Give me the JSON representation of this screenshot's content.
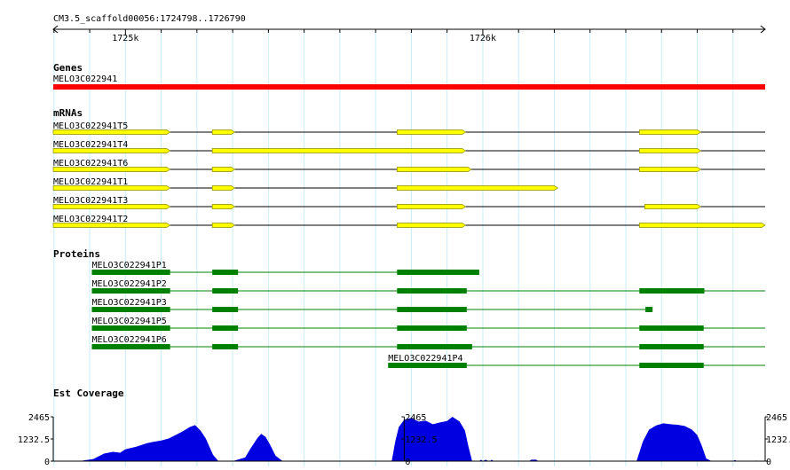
{
  "coord_label": "CM3.5_scaffold00056:1724798..1726790",
  "ruler": {
    "ticks": [
      {
        "pos": 1725000,
        "label": "1725k"
      },
      {
        "pos": 1726000,
        "label": "1726k"
      }
    ]
  },
  "range": {
    "start": 1724798,
    "end": 1726790
  },
  "colors": {
    "gene": "#ff0000",
    "mrna_fill": "#ffff00",
    "protein": "#008000",
    "coverage": "#0000e0",
    "grid": "#c8eef8"
  },
  "tracks": {
    "genes": {
      "title": "Genes",
      "items": [
        {
          "name": "MELO3C022941",
          "start": 1724798,
          "end": 1726790
        }
      ]
    },
    "mrnas": {
      "title": "mRNAs",
      "items": [
        {
          "name": "MELO3C022941T5",
          "exons": [
            [
              1724798,
              1725125
            ],
            [
              1725243,
              1725306
            ],
            [
              1725760,
              1725952
            ],
            [
              1726438,
              1726610
            ]
          ],
          "line": [
            1724798,
            1726790
          ]
        },
        {
          "name": "MELO3C022941T4",
          "exons": [
            [
              1724798,
              1725125
            ],
            [
              1725243,
              1725952
            ],
            [
              1726438,
              1726610
            ]
          ],
          "line": [
            1724798,
            1726790
          ]
        },
        {
          "name": "MELO3C022941T6",
          "exons": [
            [
              1724798,
              1725125
            ],
            [
              1725243,
              1725306
            ],
            [
              1725760,
              1725968
            ],
            [
              1726438,
              1726610
            ]
          ],
          "line": [
            1724798,
            1726790
          ]
        },
        {
          "name": "MELO3C022941T1",
          "exons": [
            [
              1724798,
              1725125
            ],
            [
              1725243,
              1725306
            ],
            [
              1725760,
              1726210
            ]
          ],
          "line": [
            1724798,
            1726210
          ]
        },
        {
          "name": "MELO3C022941T3",
          "exons": [
            [
              1724798,
              1725125
            ],
            [
              1725243,
              1725306
            ],
            [
              1725760,
              1725952
            ],
            [
              1726453,
              1726610
            ]
          ],
          "line": [
            1724798,
            1726790
          ]
        },
        {
          "name": "MELO3C022941T2",
          "exons": [
            [
              1724798,
              1725125
            ],
            [
              1725243,
              1725306
            ],
            [
              1725760,
              1725952
            ],
            [
              1726438,
              1726790
            ]
          ],
          "line": [
            1724798,
            1726790
          ]
        }
      ]
    },
    "proteins": {
      "title": "Proteins",
      "items": [
        {
          "name": "MELO3C022941P1",
          "blocks": [
            [
              1724906,
              1725125
            ],
            [
              1725243,
              1725315
            ],
            [
              1725760,
              1725990
            ]
          ],
          "line": [
            1724906,
            1725990
          ],
          "label_at": 1724906
        },
        {
          "name": "MELO3C022941P2",
          "blocks": [
            [
              1724906,
              1725125
            ],
            [
              1725243,
              1725315
            ],
            [
              1725760,
              1725955
            ],
            [
              1726438,
              1726620
            ]
          ],
          "line": [
            1724906,
            1726790
          ],
          "label_at": 1724906
        },
        {
          "name": "MELO3C022941P3",
          "blocks": [
            [
              1724906,
              1725125
            ],
            [
              1725243,
              1725315
            ],
            [
              1725760,
              1725955
            ],
            [
              1726455,
              1726475
            ]
          ],
          "line": [
            1724906,
            1726475
          ],
          "label_at": 1724906
        },
        {
          "name": "MELO3C022941P5",
          "blocks": [
            [
              1724906,
              1725125
            ],
            [
              1725243,
              1725315
            ],
            [
              1725760,
              1725955
            ],
            [
              1726438,
              1726618
            ]
          ],
          "line": [
            1724906,
            1726790
          ],
          "label_at": 1724906
        },
        {
          "name": "MELO3C022941P6",
          "blocks": [
            [
              1724906,
              1725125
            ],
            [
              1725243,
              1725315
            ],
            [
              1725760,
              1725970
            ],
            [
              1726438,
              1726618
            ]
          ],
          "line": [
            1724906,
            1726790
          ],
          "label_at": 1724906
        },
        {
          "name": "MELO3C022941P4",
          "blocks": [
            [
              1725735,
              1725955
            ],
            [
              1726438,
              1726618
            ]
          ],
          "line": [
            1725735,
            1726790
          ],
          "label_at": 1725735
        }
      ]
    },
    "coverage": {
      "title": "Est Coverage",
      "max_label": "2465",
      "mid_label": "1232.5",
      "zero_label": "0",
      "axis_positions": [
        1724798,
        1725780,
        1726790
      ],
      "points": [
        [
          1724798,
          0
        ],
        [
          1724870,
          0
        ],
        [
          1724910,
          120
        ],
        [
          1724940,
          420
        ],
        [
          1724965,
          520
        ],
        [
          1724985,
          470
        ],
        [
          1725000,
          660
        ],
        [
          1725030,
          800
        ],
        [
          1725060,
          1000
        ],
        [
          1725080,
          1080
        ],
        [
          1725100,
          1150
        ],
        [
          1725120,
          1250
        ],
        [
          1725140,
          1450
        ],
        [
          1725160,
          1650
        ],
        [
          1725180,
          1900
        ],
        [
          1725195,
          2000
        ],
        [
          1725210,
          1700
        ],
        [
          1725225,
          1250
        ],
        [
          1725245,
          350
        ],
        [
          1725260,
          0
        ],
        [
          1725300,
          0
        ],
        [
          1725335,
          200
        ],
        [
          1725350,
          700
        ],
        [
          1725370,
          1300
        ],
        [
          1725380,
          1520
        ],
        [
          1725392,
          1350
        ],
        [
          1725405,
          900
        ],
        [
          1725420,
          300
        ],
        [
          1725440,
          0
        ],
        [
          1725745,
          0
        ],
        [
          1725755,
          1100
        ],
        [
          1725765,
          1900
        ],
        [
          1725780,
          2300
        ],
        [
          1725800,
          2400
        ],
        [
          1725820,
          2200
        ],
        [
          1725840,
          2250
        ],
        [
          1725860,
          2050
        ],
        [
          1725880,
          2150
        ],
        [
          1725900,
          2230
        ],
        [
          1725915,
          2465
        ],
        [
          1725935,
          2200
        ],
        [
          1725950,
          1700
        ],
        [
          1725960,
          800
        ],
        [
          1725970,
          0
        ],
        [
          1725990,
          0
        ],
        [
          1725995,
          80
        ],
        [
          1726000,
          0
        ],
        [
          1726008,
          80
        ],
        [
          1726016,
          0
        ],
        [
          1726020,
          0
        ],
        [
          1726025,
          80
        ],
        [
          1726030,
          0
        ],
        [
          1726130,
          0
        ],
        [
          1726135,
          80
        ],
        [
          1726150,
          80
        ],
        [
          1726155,
          0
        ],
        [
          1726430,
          0
        ],
        [
          1726448,
          1100
        ],
        [
          1726465,
          1750
        ],
        [
          1726485,
          1980
        ],
        [
          1726505,
          2100
        ],
        [
          1726525,
          2050
        ],
        [
          1726545,
          2020
        ],
        [
          1726565,
          1950
        ],
        [
          1726585,
          1750
        ],
        [
          1726600,
          1450
        ],
        [
          1726612,
          900
        ],
        [
          1726625,
          150
        ],
        [
          1726640,
          0
        ],
        [
          1726700,
          0
        ],
        [
          1726705,
          60
        ],
        [
          1726712,
          0
        ],
        [
          1726760,
          0
        ],
        [
          1726765,
          40
        ],
        [
          1726770,
          0
        ],
        [
          1726790,
          0
        ]
      ]
    }
  }
}
